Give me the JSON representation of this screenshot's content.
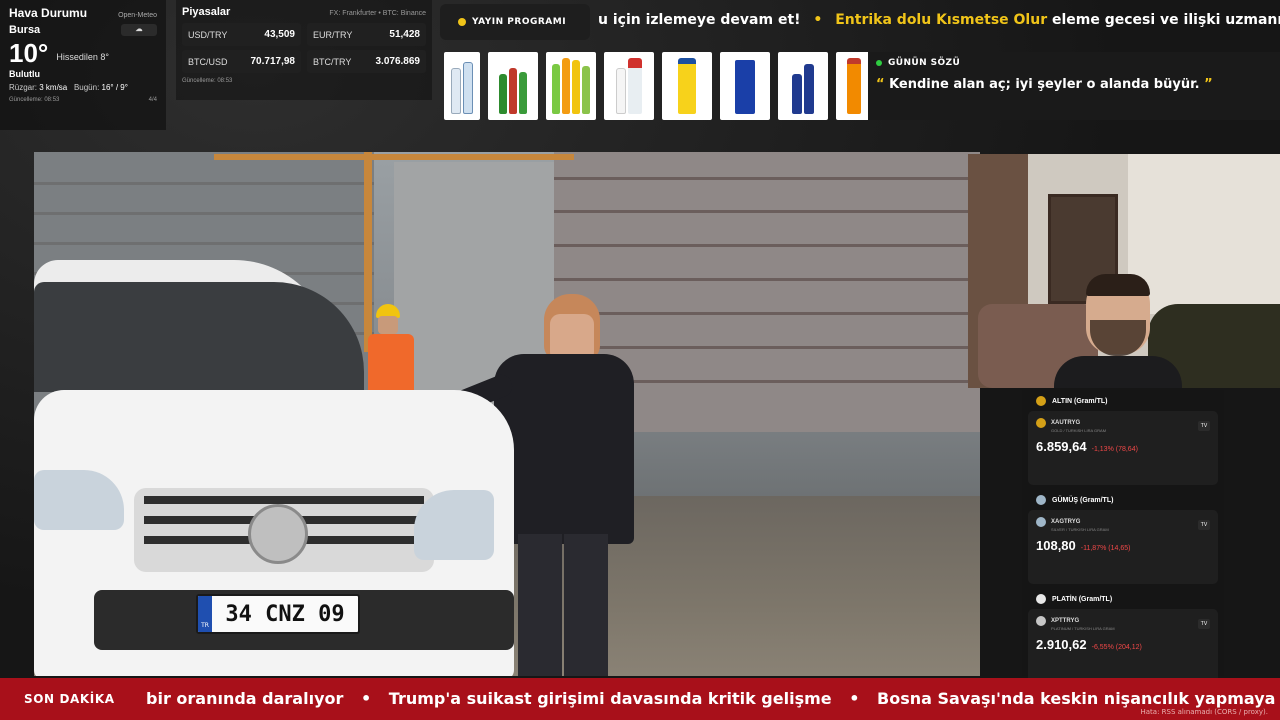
{
  "weather": {
    "title": "Hava Durumu",
    "source": "Open-Meteo",
    "city": "Bursa",
    "icon": "cloud-icon",
    "temp": "10°",
    "feels": "Hissedilen 8°",
    "condition": "Bulutlu",
    "wind_label": "Rüzgar:",
    "wind": "3 km/sa",
    "today_label": "Bugün:",
    "today": "16° / 9°",
    "updated": "Güncelleme: 08:53",
    "page": "4/4"
  },
  "markets": {
    "title": "Piyasalar",
    "source": "FX: Frankfurter • BTC: Binance",
    "items": [
      {
        "key": "USD/TRY",
        "value": "43,509"
      },
      {
        "key": "EUR/TRY",
        "value": "51,428"
      },
      {
        "key": "BTC/USD",
        "value": "70.717,98"
      },
      {
        "key": "BTC/TRY",
        "value": "3.076.869"
      }
    ],
    "updated": "Güncelleme: 08:53"
  },
  "top_ticker": {
    "badge": "YAYIN PROGRAMI",
    "text_pre": "u için izlemeye devam et!",
    "highlight": "Entrika dolu Kısmetse Olur",
    "text_post": "eleme gecesi ve ilişki uzmanı Ferh"
  },
  "quote": {
    "title": "GÜNÜN SÖZÜ",
    "open": "“",
    "text": "Kendine alan aç; iyi şeyler o alanda büyür.",
    "close": "”"
  },
  "video": {
    "plate": "34 CNZ 09",
    "plate_tr": "TR"
  },
  "metals": [
    {
      "title": "ALTIN (Gram/TL)",
      "code": "XAUTRYG",
      "sub": "GOLD / TURKISH LIRA GRAM",
      "price": "6.859,64",
      "change": "-1,13% (78,64)",
      "color": "#d4a017"
    },
    {
      "title": "GÜMÜŞ (Gram/TL)",
      "code": "XAGTRYG",
      "sub": "SILVER / TURKISH LIRA GRAM",
      "price": "108,80",
      "change": "-11,87% (14,65)",
      "color": "#9fb6c8"
    },
    {
      "title": "PLATİN (Gram/TL)",
      "code": "XPTTRYG",
      "sub": "PLATINUM / TURKISH LIRA GRAM",
      "price": "2.910,62",
      "change": "-6,55% (204,12)",
      "color": "#e8e8e8"
    }
  ],
  "metals_tv": "TV",
  "breaking": {
    "label": "SON DAKİKA",
    "items": [
      "bir oranında daralıyor",
      "Trump'a suikast girişimi davasında kritik gelişme",
      "Bosna Savaşı'nda keskin nişancılık yapmaya gidenle"
    ],
    "separator": "•",
    "rss_note": "Hata: RSS alınamadı (CORS / proxy)."
  }
}
